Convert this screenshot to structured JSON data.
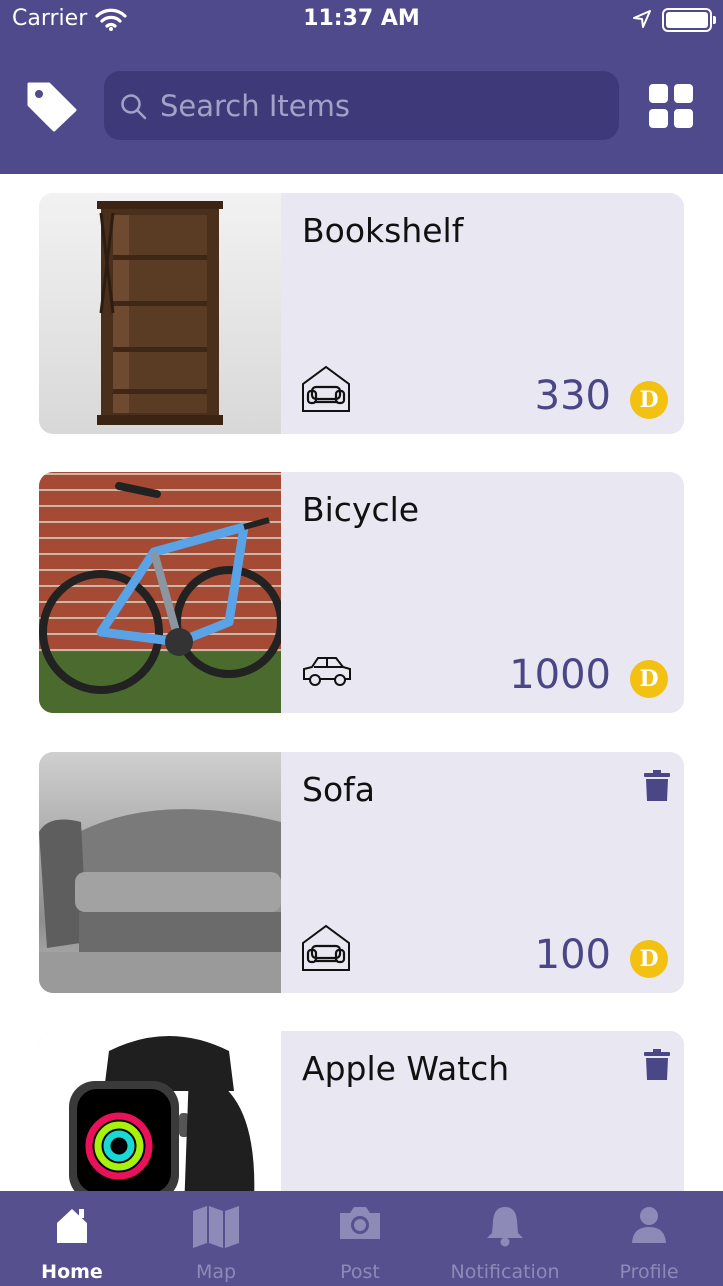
{
  "status_bar": {
    "carrier": "Carrier",
    "time": "11:37 AM"
  },
  "header": {
    "search_placeholder": "Search Items",
    "tag_icon": "tag-icon",
    "grid_icon": "grid-view-icon"
  },
  "currency_symbol": "D",
  "items": [
    {
      "title": "Bookshelf",
      "price": "330",
      "category_icon": "furniture-icon",
      "deletable": false
    },
    {
      "title": "Bicycle",
      "price": "1000",
      "category_icon": "vehicle-icon",
      "deletable": false
    },
    {
      "title": "Sofa",
      "price": "100",
      "category_icon": "furniture-icon",
      "deletable": true
    },
    {
      "title": "Apple Watch",
      "price": "",
      "category_icon": "",
      "deletable": true
    }
  ],
  "tabbar": {
    "active": "Home",
    "tabs": [
      {
        "label": "Home",
        "icon": "home-icon"
      },
      {
        "label": "Map",
        "icon": "map-icon"
      },
      {
        "label": "Post",
        "icon": "camera-icon"
      },
      {
        "label": "Notification",
        "icon": "bell-icon"
      },
      {
        "label": "Profile",
        "icon": "profile-icon"
      }
    ]
  },
  "colors": {
    "header": "#4e4a8c",
    "search_bg": "#3e3a7a",
    "card_bg": "#e8e7f2",
    "price": "#4b4686",
    "coin": "#f3c112",
    "tabbar": "#56508f"
  }
}
